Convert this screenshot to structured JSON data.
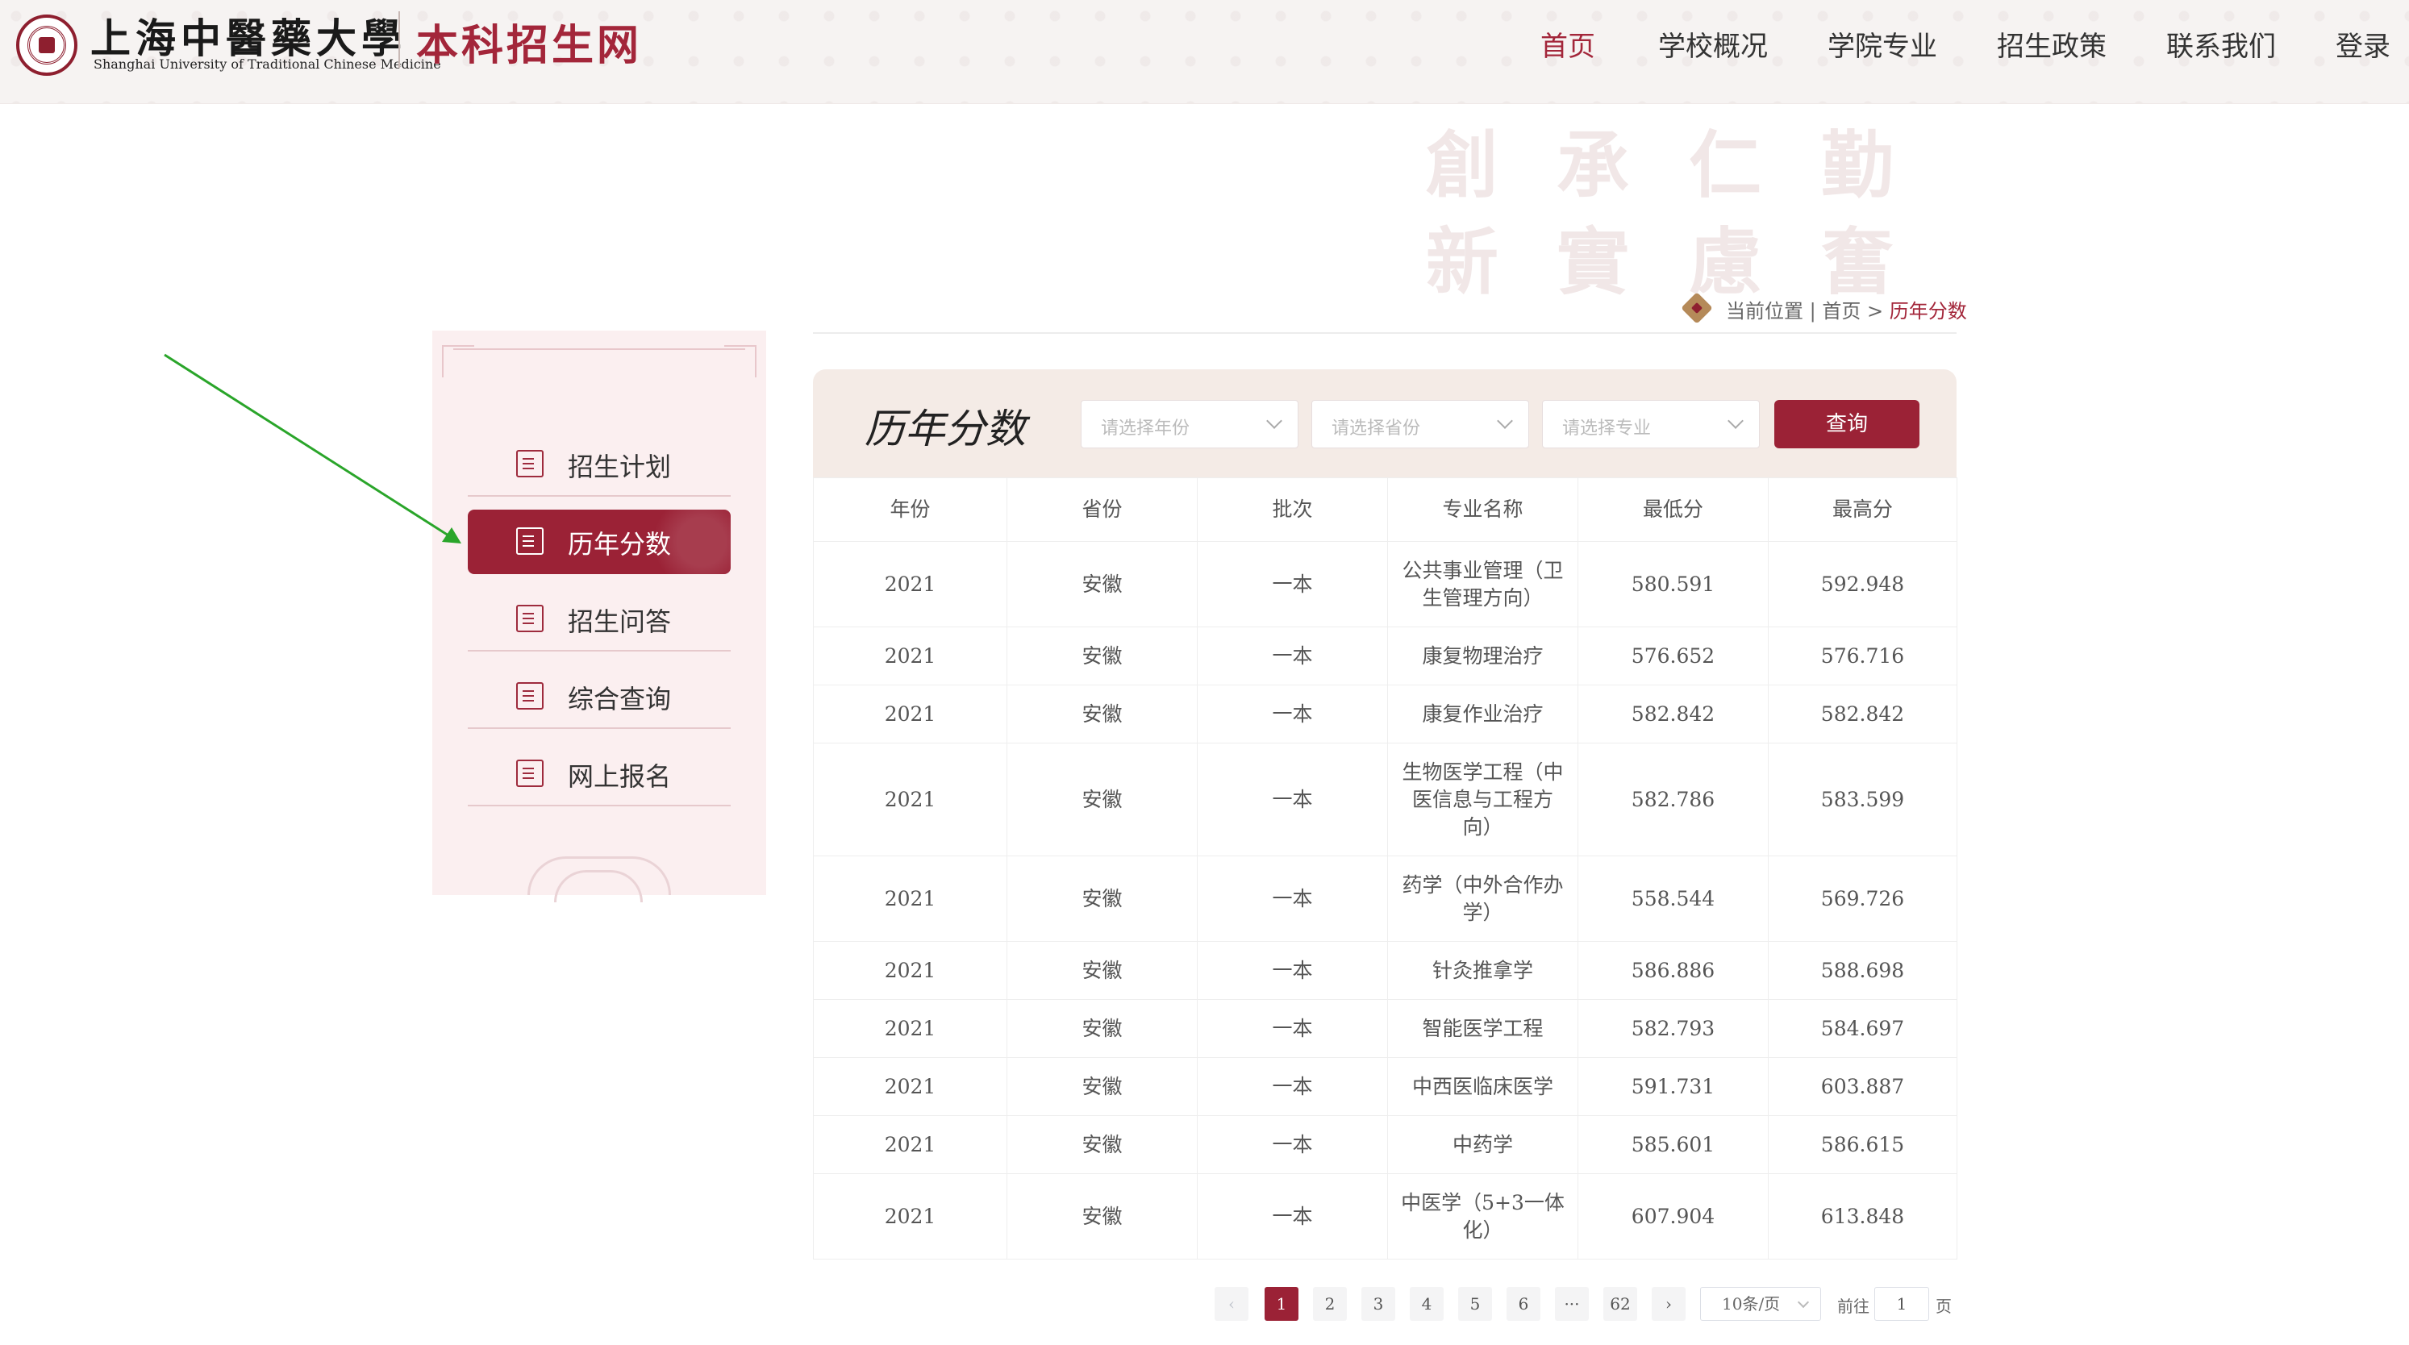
{
  "header": {
    "university_name": "上海中醫藥大學",
    "university_en": "Shanghai University of Traditional Chinese Medicine",
    "site_name": "本科招生网"
  },
  "nav": {
    "items": [
      "首页",
      "学校概况",
      "学院专业",
      "招生政策",
      "联系我们",
      "登录"
    ],
    "active_index": 0
  },
  "deco_calligraphy": [
    "創",
    "承",
    "仁",
    "勤",
    "新",
    "實",
    "慮",
    "奮"
  ],
  "breadcrumb": {
    "prefix": "当前位置 | 首页 > ",
    "current": "历年分数"
  },
  "sidebar": {
    "items": [
      {
        "label": "招生计划",
        "icon": "enrollment-plan-icon"
      },
      {
        "label": "历年分数",
        "icon": "score-history-icon"
      },
      {
        "label": "招生问答",
        "icon": "qa-icon"
      },
      {
        "label": "综合查询",
        "icon": "search-query-icon"
      },
      {
        "label": "网上报名",
        "icon": "online-signup-icon"
      }
    ],
    "active_index": 1
  },
  "panel": {
    "title": "历年分数",
    "filters": {
      "year_placeholder": "请选择年份",
      "province_placeholder": "请选择省份",
      "major_placeholder": "请选择专业"
    },
    "query_label": "查询"
  },
  "table": {
    "headers": [
      "年份",
      "省份",
      "批次",
      "专业名称",
      "最低分",
      "最高分"
    ],
    "rows": [
      [
        "2021",
        "安徽",
        "一本",
        "公共事业管理（卫生管理方向）",
        "580.591",
        "592.948"
      ],
      [
        "2021",
        "安徽",
        "一本",
        "康复物理治疗",
        "576.652",
        "576.716"
      ],
      [
        "2021",
        "安徽",
        "一本",
        "康复作业治疗",
        "582.842",
        "582.842"
      ],
      [
        "2021",
        "安徽",
        "一本",
        "生物医学工程（中医信息与工程方向）",
        "582.786",
        "583.599"
      ],
      [
        "2021",
        "安徽",
        "一本",
        "药学（中外合作办学）",
        "558.544",
        "569.726"
      ],
      [
        "2021",
        "安徽",
        "一本",
        "针灸推拿学",
        "586.886",
        "588.698"
      ],
      [
        "2021",
        "安徽",
        "一本",
        "智能医学工程",
        "582.793",
        "584.697"
      ],
      [
        "2021",
        "安徽",
        "一本",
        "中西医临床医学",
        "591.731",
        "603.887"
      ],
      [
        "2021",
        "安徽",
        "一本",
        "中药学",
        "585.601",
        "586.615"
      ],
      [
        "2021",
        "安徽",
        "一本",
        "中医学（5+3一体化）",
        "607.904",
        "613.848"
      ]
    ]
  },
  "pagination": {
    "prev": "‹",
    "next": "›",
    "pages": [
      "1",
      "2",
      "3",
      "4",
      "5",
      "6",
      "···",
      "62"
    ],
    "current": "1",
    "page_size": "10条/页",
    "goto_label": "前往",
    "goto_value": "1",
    "goto_suffix": "页"
  },
  "colors": {
    "brand": "#9b2236",
    "accent_text": "#a3263a",
    "arrow": "#2aa52a"
  }
}
